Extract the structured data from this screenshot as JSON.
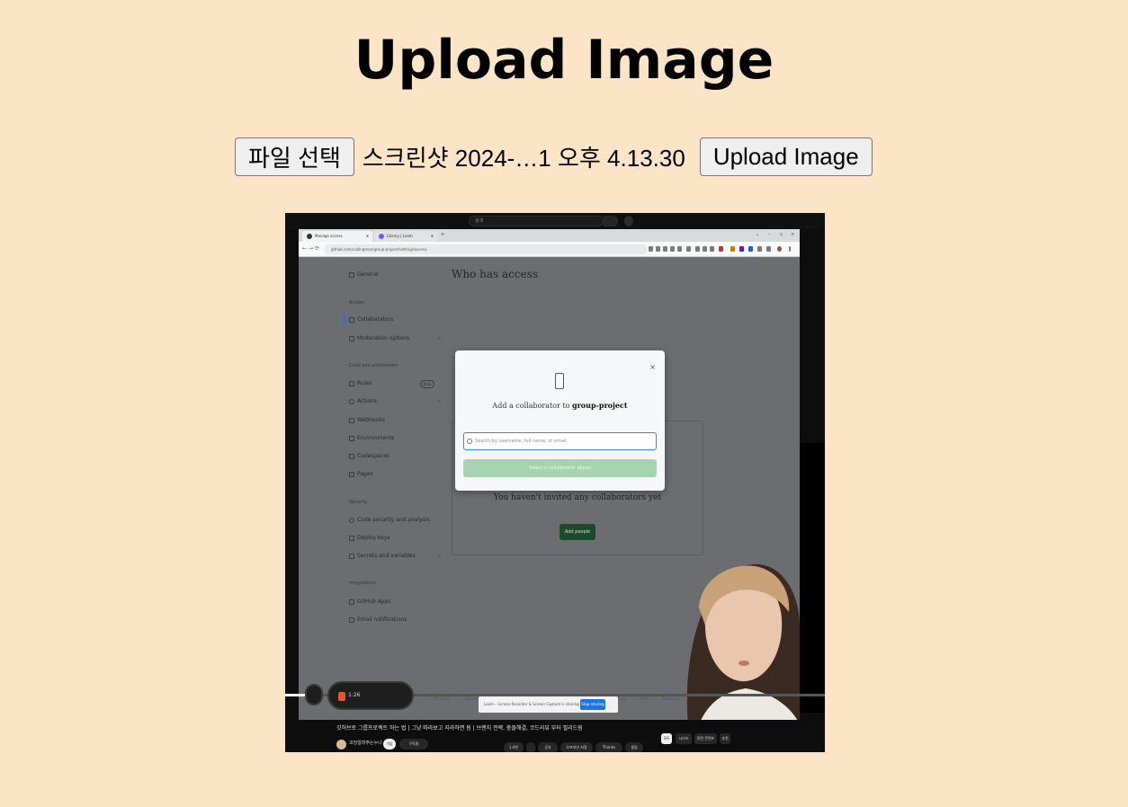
{
  "page": {
    "title": "Upload Image",
    "file_button_label": "파일 선택",
    "selected_file_name": "스크린샷 2024-…1 오후 4.13.30",
    "upload_button_label": "Upload Image"
  },
  "preview": {
    "youtube_search_placeholder": "검색",
    "browser": {
      "tabs": [
        {
          "label": "Manage access"
        },
        {
          "label": "Library | Loom"
        }
      ],
      "new_tab_glyph": "+",
      "url": "github.com/codingmon/group-project/settings/access"
    },
    "github": {
      "sidebar": {
        "general": "General",
        "access_header": "Access",
        "collaborators": "Collaborators",
        "moderation": "Moderation options",
        "code_header": "Code and automation",
        "rules": "Rules",
        "rules_badge": "Beta",
        "actions": "Actions",
        "webhooks": "Webhooks",
        "environments": "Environments",
        "codespaces": "Codespaces",
        "pages": "Pages",
        "security_header": "Security",
        "code_security": "Code security and analysis",
        "deploy_keys": "Deploy keys",
        "secrets": "Secrets and variables",
        "integrations_header": "Integrations",
        "github_apps": "GitHub Apps",
        "email_notifications": "Email notifications"
      },
      "who_has_access": "Who has access",
      "empty_text": "You haven't invited any collaborators yet",
      "add_people": "Add people",
      "footer_links": "Privacy Security Status Docs Contact GitHub Pricing API Training Blog"
    },
    "modal": {
      "close_glyph": "×",
      "title_prefix": "Add a collaborator to",
      "title_repo": "group-project",
      "search_placeholder": "Search by username, full name, or email",
      "select_button": "Select a collaborator above"
    },
    "recorder": {
      "time": "1:26",
      "share_text": "Loom – Screen Recorder & Screen Capture is sharing your screen.",
      "stop_sharing": "Stop sharing"
    },
    "youtube": {
      "video_title": "깃허브로 그룹프로젝트 하는 법 | 그냥 따라보고 지라하면 됨 | 브랜치 전략, 충돌해결, 코드리뷰 부터 필리드림",
      "channel_name": "코딩알려주는누나",
      "join": "가입",
      "subscribe": "구독중",
      "actions": [
        "1.4천",
        "공유",
        "오프라인 저장",
        "Thanks",
        "클립"
      ],
      "chips": [
        "모두",
        "시리즈",
        "관련 콘텐츠",
        "추천"
      ]
    }
  }
}
